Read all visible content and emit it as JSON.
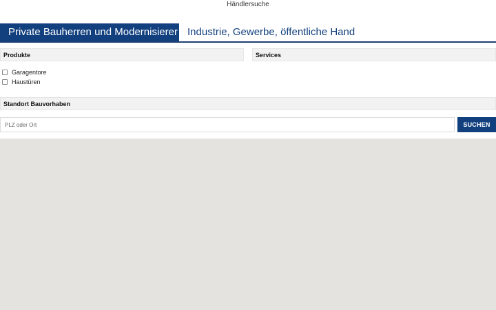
{
  "page": {
    "title": "Händlersuche"
  },
  "tabs": [
    {
      "label": "Private Bauherren und Modernisierer",
      "active": true
    },
    {
      "label": "Industrie, Gewerbe, öffentliche Hand",
      "active": false
    }
  ],
  "products": {
    "heading": "Produkte",
    "items": [
      {
        "label": "Garagentore",
        "checked": false
      },
      {
        "label": "Haustüren",
        "checked": false
      }
    ]
  },
  "services": {
    "heading": "Services"
  },
  "location": {
    "heading": "Standort Bauvorhaben",
    "input_value": "",
    "input_placeholder": "PLZ oder Ort",
    "search_label": "SUCHEN"
  },
  "colors": {
    "brand_blue": "#12407f",
    "header_bg": "#f2f2f2",
    "map_bg": "#e5e3df"
  }
}
